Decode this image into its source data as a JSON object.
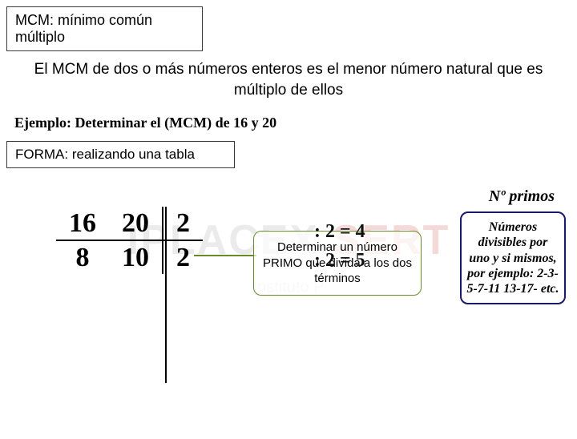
{
  "title": "MCM: mínimo común múltiplo",
  "definition": "El MCM de dos o más números enteros es el menor número natural que es múltiplo de ellos",
  "example": "Ejemplo: Determinar el (MCM) de 16 y 20",
  "forma": "FORMA: realizando una tabla",
  "primosLabel": "Nº primos",
  "primosBox": "Números divisibles por uno y si mismos, por ejemplo:\n2-3-5-7-11\n13-17- etc.",
  "table": {
    "header": [
      "16",
      "20",
      "2"
    ],
    "row1": [
      "8",
      "10",
      "2"
    ]
  },
  "callout": "Determinar un número PRIMO que divida a los dos términos",
  "division1": ": 2 = 4",
  "division2": ": 2 = 5",
  "watermark": {
    "left": "IPLACEX",
    "right": "SERT",
    "sub": "Instituto P"
  }
}
